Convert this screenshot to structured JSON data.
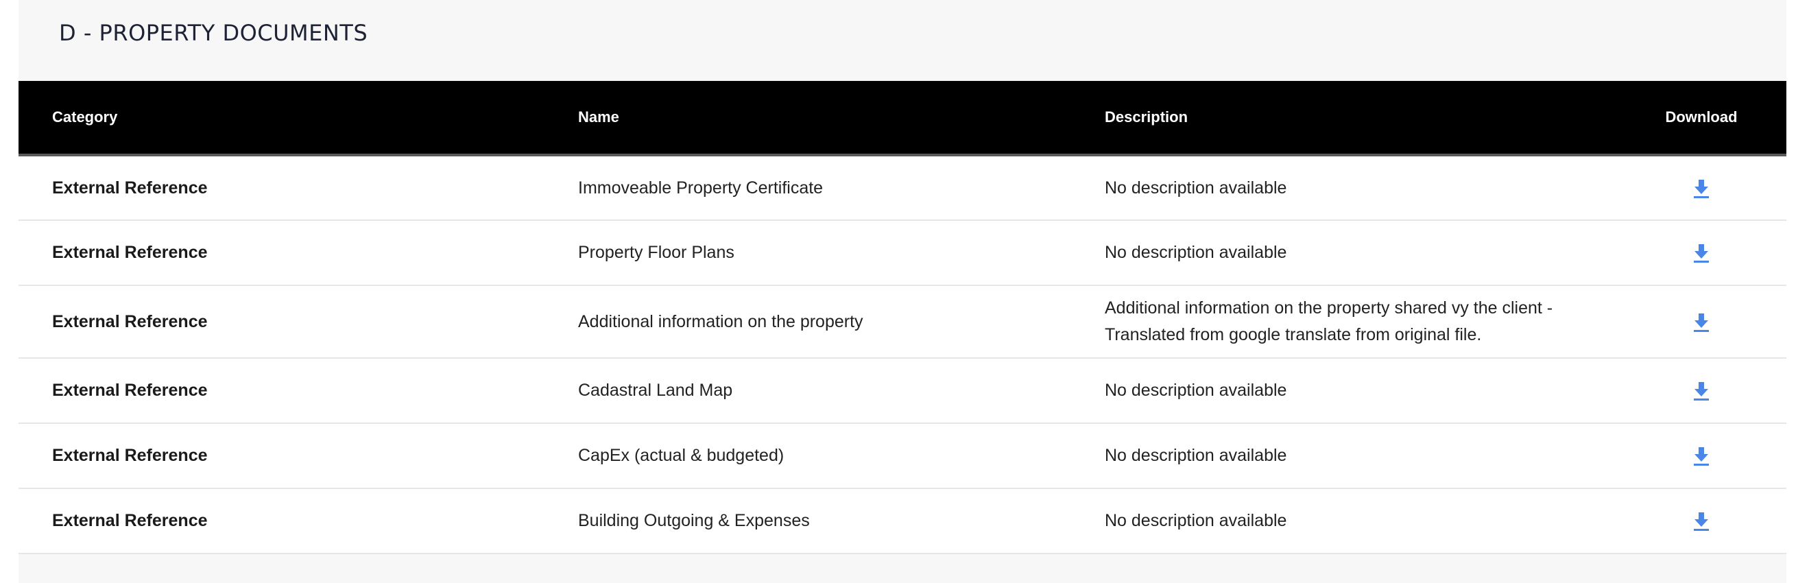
{
  "section": {
    "title": "D - PROPERTY DOCUMENTS"
  },
  "table": {
    "headers": {
      "category": "Category",
      "name": "Name",
      "description": "Description",
      "download": "Download"
    },
    "rows": [
      {
        "category": "External Reference",
        "name": "Immoveable Property Certificate",
        "description": "No description available",
        "download_icon": "download-icon"
      },
      {
        "category": "External Reference",
        "name": "Property Floor Plans",
        "description": "No description available",
        "download_icon": "download-icon"
      },
      {
        "category": "External Reference",
        "name": "Additional information on the property",
        "description": "Additional information on the property shared vy the client - Translated from google translate from original file.",
        "download_icon": "download-icon"
      },
      {
        "category": "External Reference",
        "name": "Cadastral Land Map",
        "description": "No description available",
        "download_icon": "download-icon"
      },
      {
        "category": "External Reference",
        "name": "CapEx (actual & budgeted)",
        "description": "No description available",
        "download_icon": "download-icon"
      },
      {
        "category": "External Reference",
        "name": "Building Outgoing & Expenses",
        "description": "No description available",
        "download_icon": "download-icon"
      }
    ]
  },
  "colors": {
    "header_bg": "#000000",
    "header_text": "#ffffff",
    "panel_bg": "#f7f7f7",
    "accent_icon": "#4a86e8",
    "row_border": "#e6e6e6"
  }
}
